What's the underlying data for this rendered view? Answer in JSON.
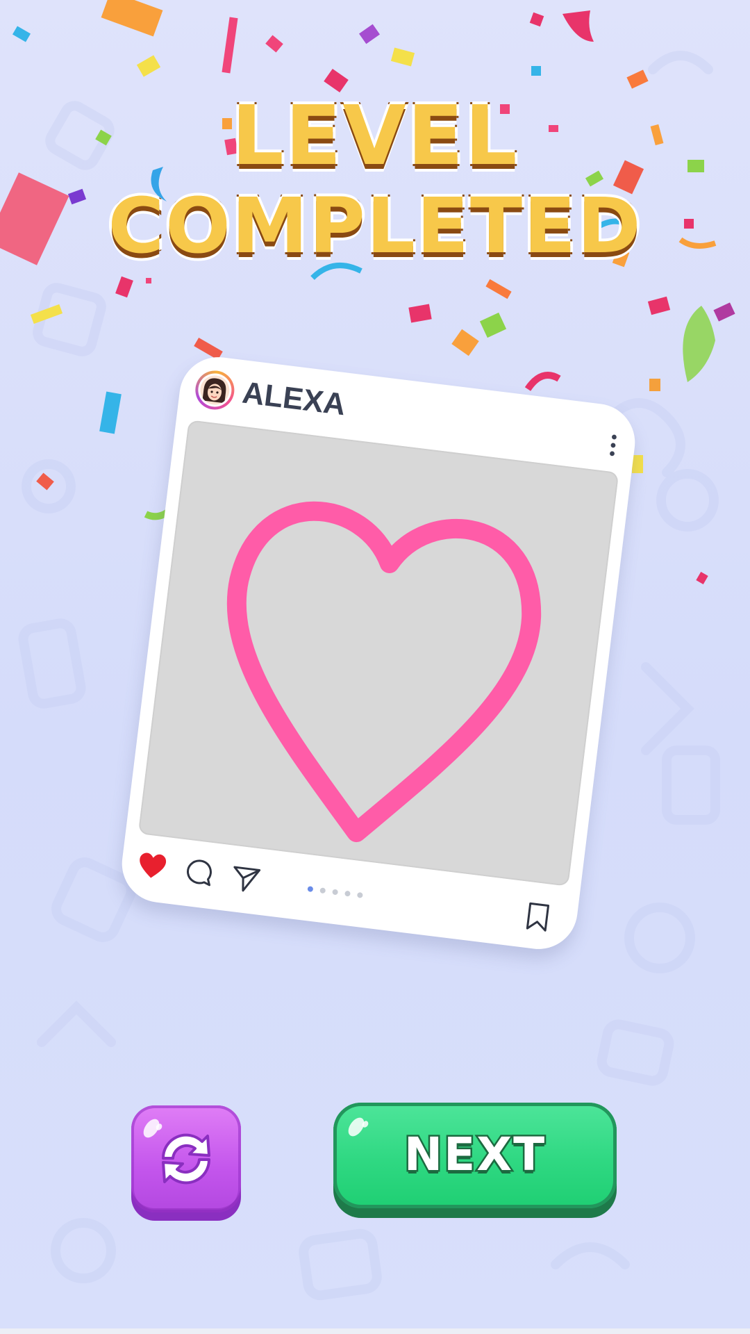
{
  "title": {
    "line1": "LEVEL",
    "line2": "COMPLETED"
  },
  "post": {
    "username": "ALEXA",
    "avatar_icon": "girl-avatar-icon",
    "photo_icon": "pink-heart-drawing",
    "liked": true,
    "carousel_total": 5,
    "carousel_active": 1
  },
  "buttons": {
    "restart_icon": "restart-icon",
    "next_label": "NEXT"
  },
  "colors": {
    "heart_stroke": "#ff5ca8",
    "like_red": "#e8202e",
    "next_green": "#2fd882",
    "restart_purple": "#c355ec",
    "title_gold": "#f7c84a"
  }
}
